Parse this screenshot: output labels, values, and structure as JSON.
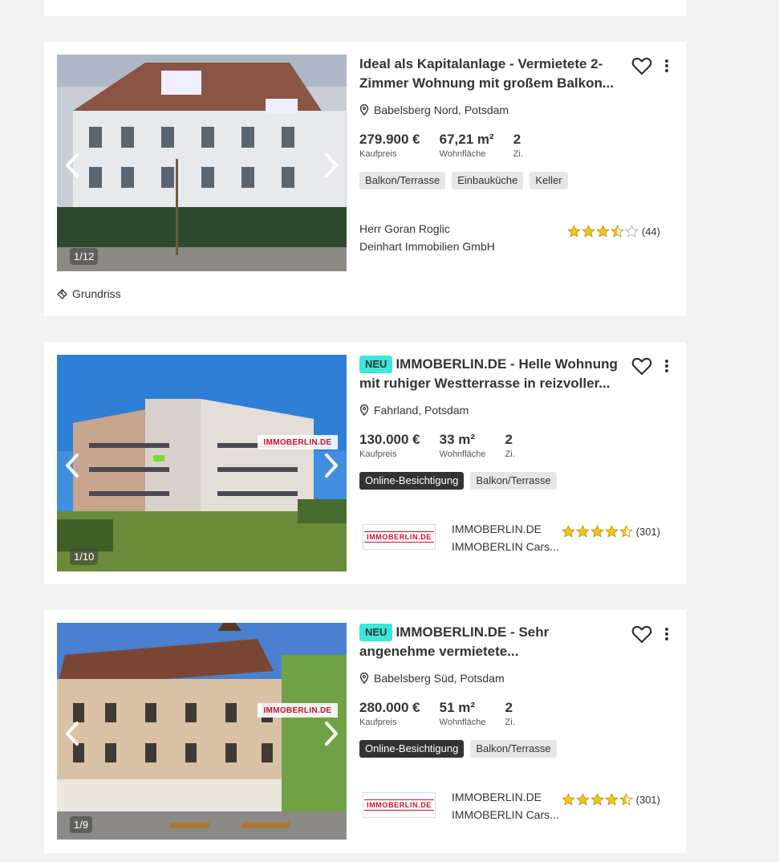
{
  "listings": [
    {
      "badge": "",
      "title": "Ideal als Kapitalanlage - Vermietete 2-Zimmer Wohnung mit großem Balkon...",
      "location": "Babelsberg Nord, Potsdam",
      "price": "279.900 €",
      "price_label": "Kaufpreis",
      "area": "67,21 m²",
      "area_label": "Wohnfläche",
      "rooms": "2",
      "rooms_label": "Zi.",
      "tags": [
        "Balkon/Terrasse",
        "Einbauküche",
        "Keller"
      ],
      "image_counter": "1/12",
      "agent_name": "Herr Goran Roglic",
      "agent_company": "Deinhart Immobilien GmbH",
      "rating_stars": 3.5,
      "rating_count": "(44)",
      "floorplan_label": "Grundriss"
    },
    {
      "badge": "NEU",
      "title": "IMMOBERLIN.DE - Helle Wohnung mit ruhiger Westterrasse in reizvoller...",
      "location": "Fahrland, Potsdam",
      "price": "130.000 €",
      "price_label": "Kaufpreis",
      "area": "33 m²",
      "area_label": "Wohnfläche",
      "rooms": "2",
      "rooms_label": "Zi.",
      "tags_dark": [
        "Online-Besichtigung"
      ],
      "tags": [
        "Balkon/Terrasse"
      ],
      "image_counter": "1/10",
      "image_watermark": "IMMOBERLIN.DE",
      "agent_logo_text": "IMMOBERLIN.DE",
      "agent_name": "IMMOBERLIN.DE",
      "agent_company": "IMMOBERLIN Cars...",
      "rating_stars": 4.5,
      "rating_count": "(301)"
    },
    {
      "badge": "NEU",
      "title": "IMMOBERLIN.DE - Sehr angenehme vermietete...",
      "location": "Babelsberg Süd, Potsdam",
      "price": "280.000 €",
      "price_label": "Kaufpreis",
      "area": "51 m²",
      "area_label": "Wohnfläche",
      "rooms": "2",
      "rooms_label": "Zi.",
      "tags_dark": [
        "Online-Besichtigung"
      ],
      "tags": [
        "Balkon/Terrasse"
      ],
      "image_counter": "1/9",
      "image_watermark": "IMMOBERLIN.DE",
      "agent_logo_text": "IMMOBERLIN.DE",
      "agent_name": "IMMOBERLIN.DE",
      "agent_company": "IMMOBERLIN Cars...",
      "rating_stars": 4.5,
      "rating_count": "(301)"
    }
  ],
  "colors": {
    "neu_badge": "#3ce8d7",
    "star": "#f5c518",
    "dark_tag": "#333333",
    "page_bg": "#f2f2f2"
  },
  "icons": [
    "heart-icon",
    "more-vertical-icon",
    "location-pin-icon",
    "chevron-left-icon",
    "chevron-right-icon",
    "floorplan-icon",
    "star-icon"
  ]
}
